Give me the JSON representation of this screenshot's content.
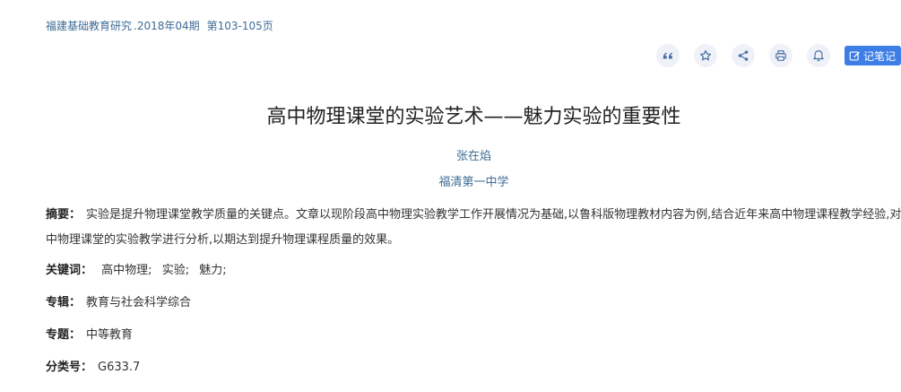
{
  "source": {
    "journal": "福建基础教育研究",
    "year_issue": ".2018年04期",
    "pages": "第103-105页"
  },
  "toolbar": {
    "quote_icon": "quote-icon",
    "star_icon": "star-icon",
    "share_icon": "share-icon",
    "print_icon": "print-icon",
    "bell_icon": "bell-icon",
    "note_label": "记笔记"
  },
  "article": {
    "title": "高中物理课堂的实验艺术——魅力实验的重要性",
    "author": "张在焰",
    "organization": "福清第一中学"
  },
  "abstract": {
    "label": "摘要：",
    "text": "实验是提升物理课堂教学质量的关键点。文章以现阶段高中物理实验教学工作开展情况为基础,以鲁科版物理教材内容为例,结合近年来高中物理课程教学经验,对高中物理课堂的实验教学进行分析,以期达到提升物理课程质量的效果。"
  },
  "keywords": {
    "label": "关键词：",
    "items": [
      "高中物理;",
      "实验;",
      "魅力;"
    ]
  },
  "series": {
    "label": "专辑：",
    "value": "教育与社会科学综合"
  },
  "subject": {
    "label": "专题：",
    "value": "中等教育"
  },
  "classification": {
    "label": "分类号：",
    "value": "G633.7"
  },
  "colors": {
    "link": "#3f6c97",
    "accent": "#3d7ee6",
    "icon_bg": "#eef2f8"
  }
}
